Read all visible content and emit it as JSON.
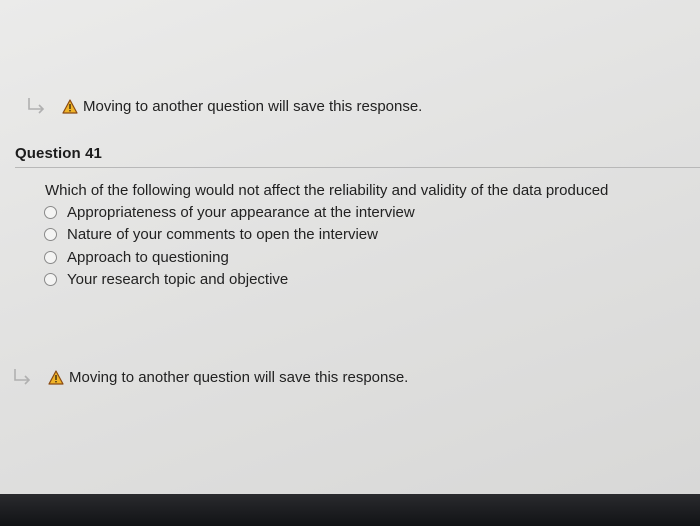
{
  "notices": {
    "top": {
      "text": "Moving to another question will save this response.",
      "icon": "warning-icon"
    },
    "bottom": {
      "text": "Moving to another question will save this response.",
      "icon": "warning-icon"
    }
  },
  "question": {
    "title": "Question 41",
    "text": "Which of the following would not affect the reliability and validity of the data produced",
    "options": [
      "Appropriateness of your appearance at the interview",
      "Nature of your comments to open the interview",
      "Approach to questioning",
      "Your research topic and objective"
    ]
  },
  "colors": {
    "warning_fill": "#f0b429",
    "warning_border": "#b5651d",
    "arrow_color": "#b0b0b0"
  }
}
